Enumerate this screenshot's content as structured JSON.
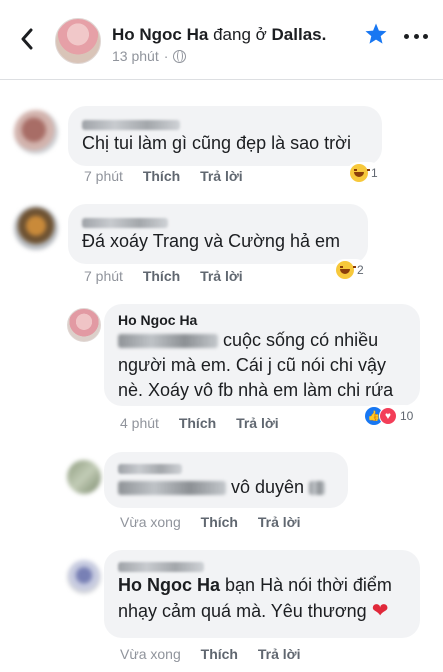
{
  "header": {
    "name": "Ho Ngoc Ha",
    "location_prefix": "đang ở",
    "location": "Dallas.",
    "time": "13 phút"
  },
  "colors": {
    "accent": "#1877f2",
    "bubble": "#f2f3f5",
    "meta": "#90949c"
  },
  "comments": [
    {
      "text": "Chị tui làm gì cũng đẹp là sao trời",
      "time": "7 phút",
      "like": "Thích",
      "reply": "Trả lời",
      "reaction_icon": "haha-emoji",
      "reaction_count": "1"
    },
    {
      "text": "Đá xoáy Trang và  Cường hả em",
      "time": "7 phút",
      "like": "Thích",
      "reply": "Trả lời",
      "reaction_icon": "haha-emoji",
      "reaction_count": "2"
    },
    {
      "name": "Ho Ngoc Ha",
      "line1": "cuộc sống có nhiều",
      "line2": "người mà em. Cái j cũ nói chi vậy",
      "line3": "nè. Xoáy vô fb nhà em làm chi rứa",
      "time": "4 phút",
      "like": "Thích",
      "reply": "Trả lời",
      "reaction_icons": [
        "like-icon",
        "love-icon"
      ],
      "reaction_count": "10"
    },
    {
      "text": "vô duyên",
      "time": "Vừa xong",
      "like": "Thích",
      "reply": "Trả lời"
    },
    {
      "mention": "Ho Ngoc Ha",
      "line1": "bạn Hà nói thời điểm",
      "line2": "nhạy cảm quá mà. Yêu thương",
      "time": "Vừa xong",
      "like": "Thích",
      "reply": "Trả lời"
    }
  ]
}
